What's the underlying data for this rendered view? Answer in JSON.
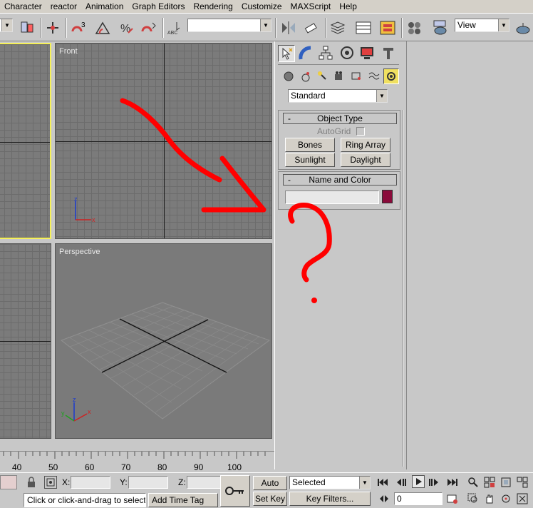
{
  "menu": [
    "Character",
    "reactor",
    "Animation",
    "Graph Editors",
    "Rendering",
    "Customize",
    "MAXScript",
    "Help"
  ],
  "toolbar": {
    "selection_set_value": "",
    "refcoord_value": "View",
    "icons": [
      "mirror-icon",
      "align-icon",
      "layers-icon",
      "curve-editor-icon",
      "schematic-icon",
      "material-editor-icon",
      "render-teapot-icon",
      "quick-render-icon"
    ]
  },
  "viewports": {
    "front": {
      "label": "Front"
    },
    "perspective": {
      "label": "Perspective"
    }
  },
  "command_panel": {
    "tabs": [
      "create-tab",
      "modify-tab",
      "hierarchy-tab",
      "motion-tab",
      "display-tab",
      "utilities-tab"
    ],
    "categories": [
      "geometry",
      "shapes",
      "lights",
      "cameras",
      "helpers",
      "space-warps",
      "systems"
    ],
    "dropdown_value": "Standard",
    "object_type": {
      "title": "Object Type",
      "autogrid_label": "AutoGrid",
      "buttons": [
        "Bones",
        "Ring Array",
        "Sunlight",
        "Daylight"
      ]
    },
    "name_color": {
      "title": "Name and Color",
      "name_value": "",
      "color": "#8a0a3a"
    }
  },
  "timeline": {
    "ticks": [
      "40",
      "50",
      "60",
      "70",
      "80",
      "90",
      "100"
    ]
  },
  "status": {
    "x_label": "X:",
    "y_label": "Y:",
    "z_label": "Z:",
    "prompt": "Click or click-and-drag to select obj",
    "add_time_tag": "Add Time Tag",
    "auto_key": "Auto Key",
    "set_key": "Set Key",
    "key_filter_select": "Selected",
    "key_filters": "Key Filters...",
    "frame_value": "0"
  },
  "colors": {
    "annotation": "#ff0000",
    "active_viewport_border": "#f5f05a"
  }
}
